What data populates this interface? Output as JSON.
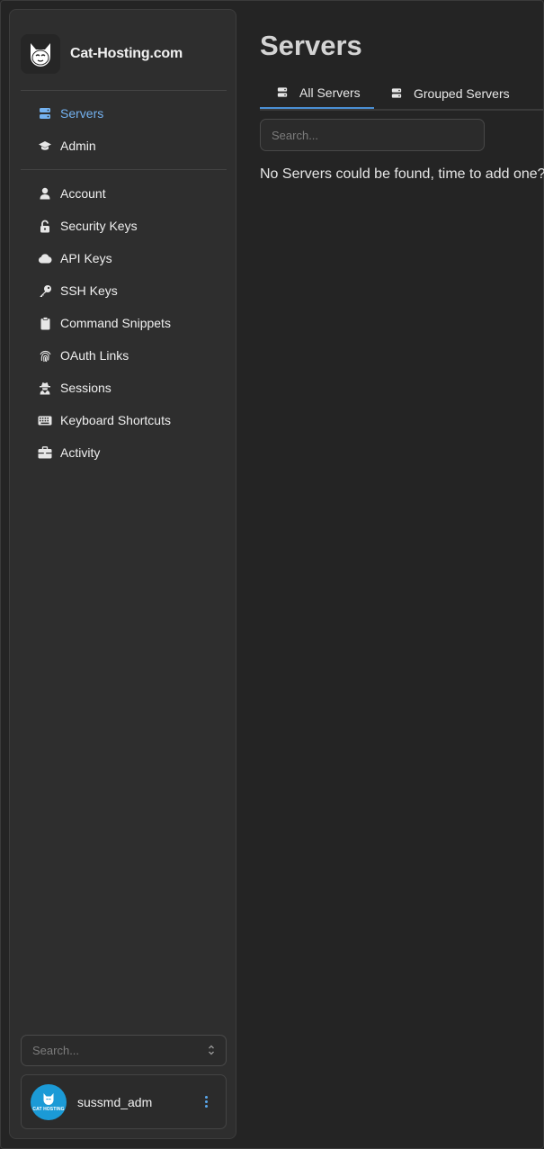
{
  "brand": {
    "name": "Cat-Hosting.com"
  },
  "nav": {
    "primary": [
      {
        "label": "Servers",
        "icon": "server-icon",
        "active": true
      },
      {
        "label": "Admin",
        "icon": "graduation-cap-icon",
        "active": false
      }
    ],
    "secondary": [
      {
        "label": "Account",
        "icon": "user-icon"
      },
      {
        "label": "Security Keys",
        "icon": "unlock-icon"
      },
      {
        "label": "API Keys",
        "icon": "cloud-icon"
      },
      {
        "label": "SSH Keys",
        "icon": "key-icon"
      },
      {
        "label": "Command Snippets",
        "icon": "clipboard-icon"
      },
      {
        "label": "OAuth Links",
        "icon": "fingerprint-icon"
      },
      {
        "label": "Sessions",
        "icon": "user-secret-icon"
      },
      {
        "label": "Keyboard Shortcuts",
        "icon": "keyboard-icon"
      },
      {
        "label": "Activity",
        "icon": "briefcase-icon"
      }
    ]
  },
  "sidebar_search": {
    "placeholder": "Search..."
  },
  "user": {
    "name": "sussmd_adm",
    "avatar_text": "CAT HOSTING"
  },
  "page": {
    "title": "Servers",
    "tabs": [
      {
        "label": "All Servers",
        "active": true
      },
      {
        "label": "Grouped Servers",
        "active": false
      }
    ],
    "search_placeholder": "Search...",
    "empty_message": "No Servers could be found, time to add one?"
  },
  "colors": {
    "accent": "#74b2f0",
    "background": "#242424",
    "sidebar": "#2e2e2e",
    "avatar": "#1b9ad6"
  }
}
